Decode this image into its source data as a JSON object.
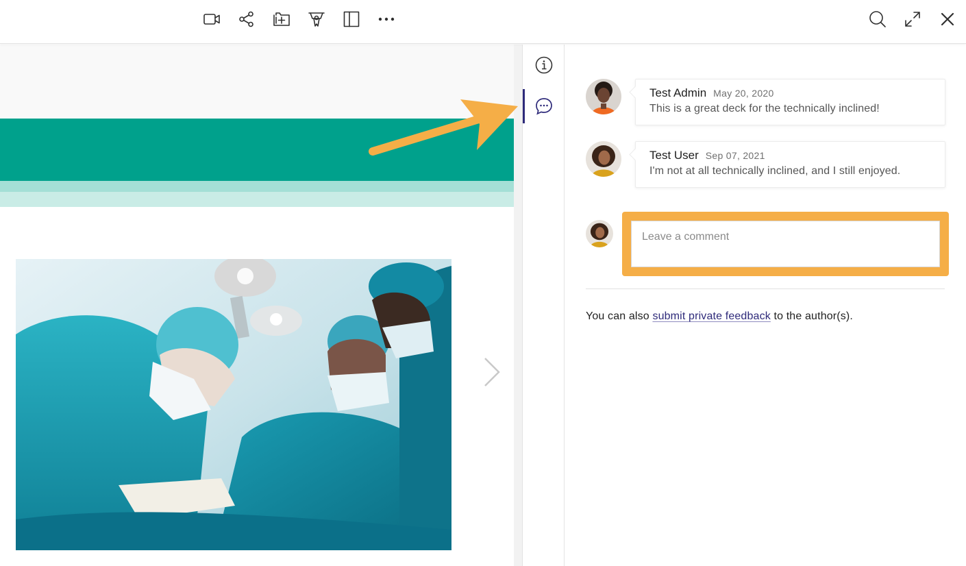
{
  "toolbar": {
    "left_icons": [
      "video-icon",
      "share-icon",
      "add-to-folder-icon",
      "certificate-icon",
      "panel-layout-icon",
      "more-icon"
    ],
    "right_icons": [
      "search-icon",
      "expand-icon",
      "close-icon"
    ]
  },
  "rail": {
    "items": [
      {
        "icon": "info-icon",
        "active": false
      },
      {
        "icon": "comment-icon",
        "active": true
      }
    ],
    "accent_color": "#2e2a7a"
  },
  "slide": {
    "band_colors": [
      "#00a18c",
      "#a4dfd6",
      "#c9ece6"
    ],
    "image": "surgeons-operating-photo",
    "next_icon": "chevron-right-icon"
  },
  "comments": [
    {
      "author": "Test Admin",
      "date": "May 20, 2020",
      "text": "This is a great deck for the technically inclined!"
    },
    {
      "author": "Test User",
      "date": "Sep 07, 2021",
      "text": "I'm not at all technically inclined, and I still enjoyed."
    }
  ],
  "new_comment": {
    "placeholder": "Leave a comment",
    "value": ""
  },
  "feedback": {
    "prefix": "You can also ",
    "link": "submit private feedback",
    "suffix": " to the author(s)."
  },
  "annotation_color": "#f5ae47"
}
